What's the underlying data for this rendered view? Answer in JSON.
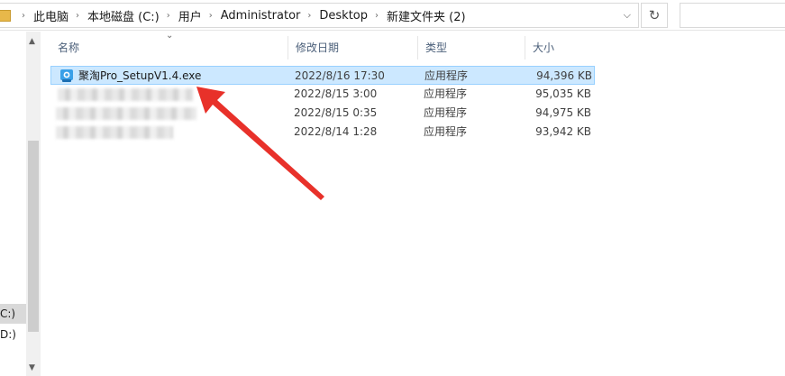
{
  "address_bar": {
    "breadcrumbs": [
      "此电脑",
      "本地磁盘 (C:)",
      "用户",
      "Administrator",
      "Desktop",
      "新建文件夹 (2)"
    ],
    "separator": "›",
    "dropdown_glyph": "⌵",
    "refresh_glyph": "↻"
  },
  "nav_pane": {
    "drives": [
      {
        "label": "C:)",
        "selected": true
      },
      {
        "label": "D:)",
        "selected": false
      }
    ]
  },
  "columns": {
    "name": "名称",
    "date": "修改日期",
    "type": "类型",
    "size": "大小"
  },
  "files": [
    {
      "name": "聚淘Pro_SetupV1.4.exe",
      "date": "2022/8/16 17:30",
      "type": "应用程序",
      "size": "94,396 KB",
      "selected": true,
      "name_obscured": false
    },
    {
      "name": "",
      "date": "2022/8/15 3:00",
      "type": "应用程序",
      "size": "95,035 KB",
      "selected": false,
      "name_obscured": true
    },
    {
      "name": "",
      "date": "2022/8/15 0:35",
      "type": "应用程序",
      "size": "94,975 KB",
      "selected": false,
      "name_obscured": true
    },
    {
      "name": "",
      "date": "2022/8/14 1:28",
      "type": "应用程序",
      "size": "93,942 KB",
      "selected": false,
      "name_obscured": true
    }
  ],
  "colors": {
    "selection_bg": "#cce8ff",
    "selection_border": "#99d1ff",
    "annotation_arrow": "#e8312a",
    "header_text": "#4c607a"
  },
  "icons": {
    "folder": "folder-icon",
    "exe": "app-installer-icon"
  }
}
